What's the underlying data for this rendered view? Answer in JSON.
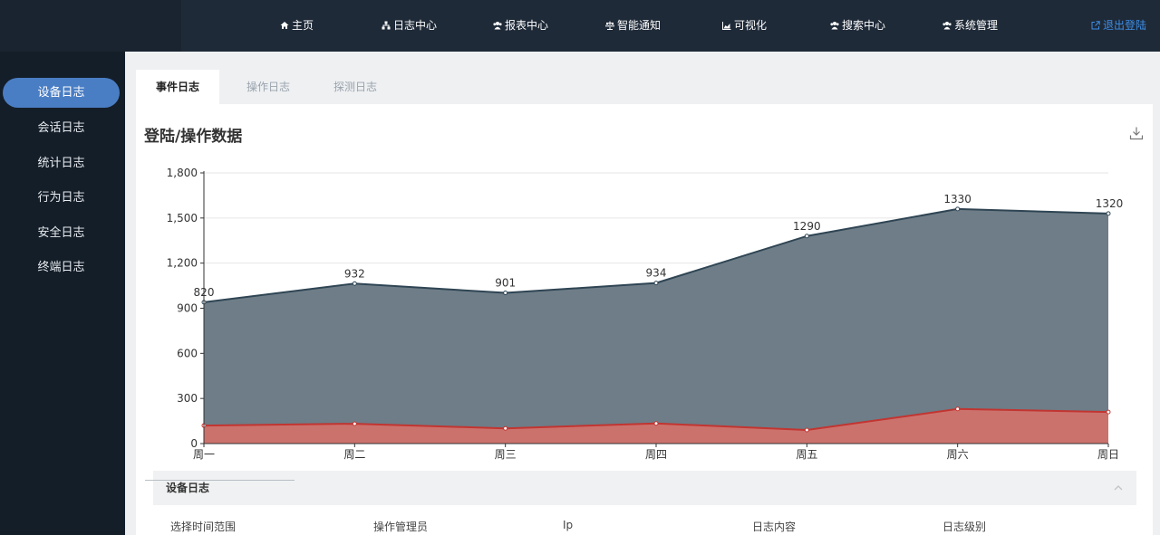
{
  "nav": {
    "items": [
      {
        "label": "主页",
        "icon": "home-icon"
      },
      {
        "label": "日志中心",
        "icon": "sitemap-icon"
      },
      {
        "label": "报表中心",
        "icon": "users-icon"
      },
      {
        "label": "智能通知",
        "icon": "balance-icon"
      },
      {
        "label": "可视化",
        "icon": "area-chart-icon"
      },
      {
        "label": "搜索中心",
        "icon": "users-icon"
      },
      {
        "label": "系统管理",
        "icon": "users-icon"
      }
    ],
    "logout": {
      "label": "退出登陆",
      "icon": "external-link-icon"
    }
  },
  "sidebar": {
    "items": [
      {
        "label": "设备日志",
        "active": true
      },
      {
        "label": "会话日志"
      },
      {
        "label": "统计日志"
      },
      {
        "label": "行为日志"
      },
      {
        "label": "安全日志"
      },
      {
        "label": "终端日志"
      }
    ]
  },
  "tabs": [
    {
      "label": "事件日志",
      "active": true
    },
    {
      "label": "操作日志"
    },
    {
      "label": "探测日志"
    }
  ],
  "panel": {
    "title": "登陆/操作数据"
  },
  "colors": {
    "series_upper": "#6e7d87",
    "series_upper_line": "#2f4554",
    "series_lower": "#cc726d",
    "series_lower_line": "#c23531",
    "grid": "#e6e6e6",
    "axis": "#333333"
  },
  "chart_data": {
    "type": "area",
    "stacked": true,
    "categories": [
      "周一",
      "周二",
      "周三",
      "周四",
      "周五",
      "周六",
      "周日"
    ],
    "ylim": [
      0,
      1800
    ],
    "yticks": [
      0,
      300,
      600,
      1200,
      1500,
      1800,
      900
    ],
    "ytick_labels": [
      "0",
      "300",
      "600",
      "1,200",
      "1,500",
      "1,800",
      "900"
    ],
    "grid": true,
    "series": [
      {
        "values": [
          120,
          132,
          101,
          134,
          90,
          230,
          210
        ]
      },
      {
        "values": [
          820,
          932,
          901,
          934,
          1290,
          1330,
          1320
        ],
        "labels": [
          "820",
          "932",
          "901",
          "934",
          "1290",
          "1330",
          "1320"
        ]
      }
    ]
  },
  "subpanel": {
    "title": "设备日志"
  },
  "filters": [
    {
      "label": "选择时间范围"
    },
    {
      "label": "操作管理员"
    },
    {
      "label": "Ip"
    },
    {
      "label": "日志内容"
    },
    {
      "label": "日志级别"
    }
  ]
}
